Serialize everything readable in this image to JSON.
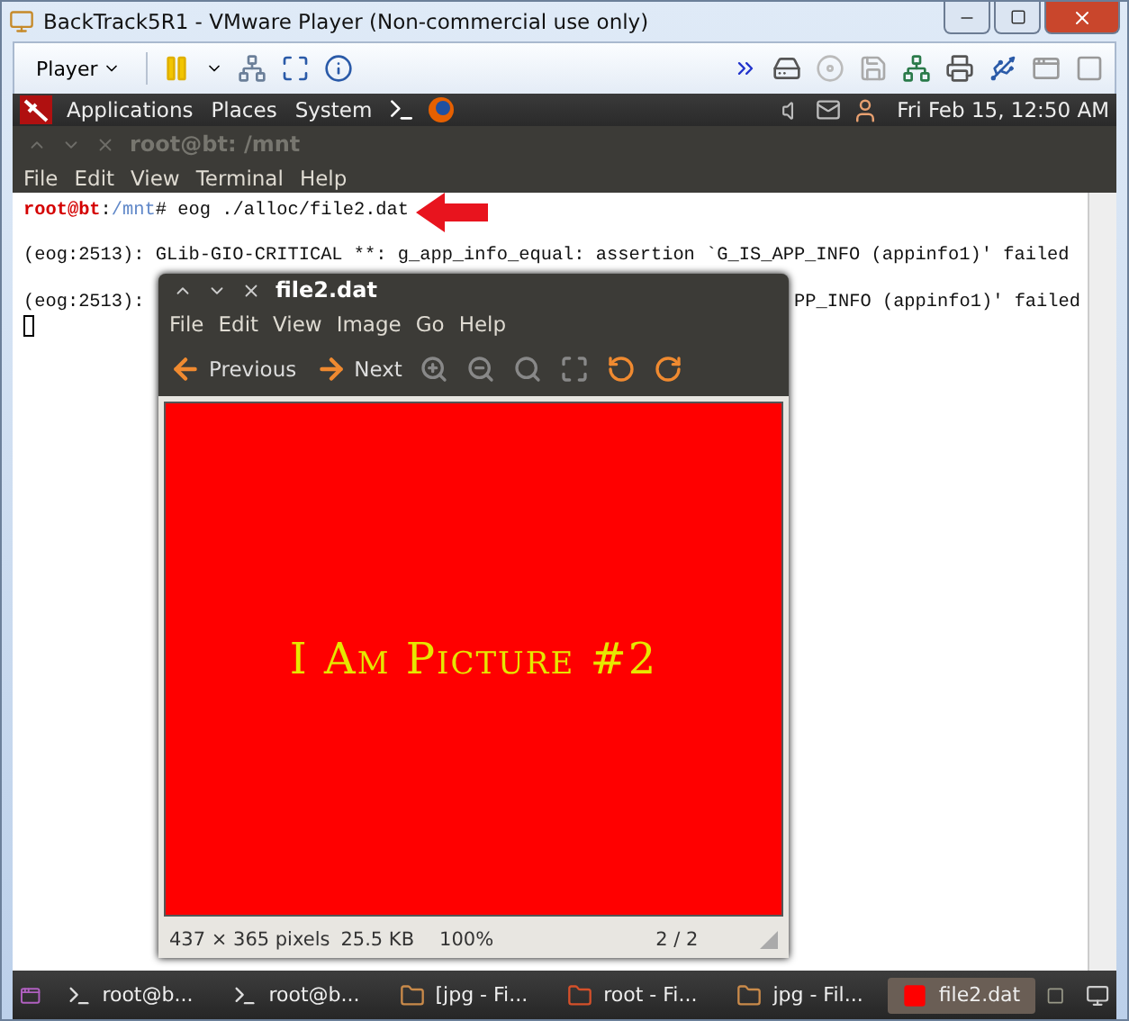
{
  "window": {
    "title": "BackTrack5R1 - VMware Player (Non-commercial use only)"
  },
  "vm_toolbar": {
    "player_menu": "Player"
  },
  "guest_panel": {
    "menus": [
      {
        "label": "Applications"
      },
      {
        "label": "Places"
      },
      {
        "label": "System"
      }
    ],
    "clock": "Fri Feb 15, 12:50 AM"
  },
  "terminal": {
    "title": "root@bt: /mnt",
    "menu": [
      "File",
      "Edit",
      "View",
      "Terminal",
      "Help"
    ],
    "prompt": {
      "user": "root@bt",
      "sep": ":",
      "path": "/mnt",
      "symbol": "#",
      "command": "eog ./alloc/file2.dat"
    },
    "lines": [
      {
        "kind": "full",
        "text": "(eog:2513): GLib-GIO-CRITICAL **: g_app_info_equal: assertion `G_IS_APP_INFO (appinfo1)' failed"
      },
      {
        "kind": "split",
        "left": "(eog:2513):",
        "right": "PP_INFO (appinfo1)' failed"
      }
    ]
  },
  "image_viewer": {
    "title": "file2.dat",
    "menu": [
      "File",
      "Edit",
      "View",
      "Image",
      "Go",
      "Help"
    ],
    "toolbar": [
      {
        "kind": "prev",
        "label": "Previous"
      },
      {
        "kind": "next",
        "label": "Next"
      },
      {
        "kind": "zoom-in"
      },
      {
        "kind": "zoom-out"
      },
      {
        "kind": "zoom-normal"
      },
      {
        "kind": "zoom-fit"
      },
      {
        "kind": "rotate-left"
      },
      {
        "kind": "rotate-right"
      }
    ],
    "picture_text": "I Am Picture #2",
    "status": {
      "dimensions": "437 × 365 pixels",
      "size": "25.5 KB",
      "zoom": "100%",
      "position": "2 / 2"
    }
  },
  "taskbar": [
    {
      "kind": "terminal",
      "label": "root@b...",
      "selected": false
    },
    {
      "kind": "terminal",
      "label": "root@b...",
      "selected": false
    },
    {
      "kind": "folder",
      "label": "[jpg - Fi...",
      "selected": false
    },
    {
      "kind": "folder-red",
      "label": "root - Fi...",
      "selected": false
    },
    {
      "kind": "folder",
      "label": "jpg - Fil...",
      "selected": false
    },
    {
      "kind": "image",
      "label": "file2.dat",
      "selected": true
    }
  ]
}
